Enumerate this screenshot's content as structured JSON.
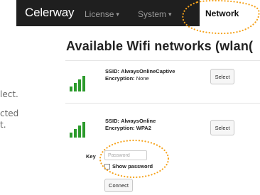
{
  "navbar": {
    "brand": "Celerway",
    "items": [
      {
        "label": "License",
        "caret": "▾"
      },
      {
        "label": "System",
        "caret": "▾"
      },
      {
        "label": "Network"
      }
    ]
  },
  "page": {
    "title": "Available Wifi networks (wlan("
  },
  "side_text": [
    "lect.",
    "cted",
    "t."
  ],
  "networks": [
    {
      "ssid_label": "SSID:",
      "ssid": "AlwaysOnlineCaptive",
      "enc_label": "Encryption:",
      "encryption": "None",
      "select_label": "Select"
    },
    {
      "ssid_label": "SSID:",
      "ssid": "AlwaysOnline",
      "enc_label": "Encryption:",
      "encryption": "WPA2",
      "select_label": "Select"
    }
  ],
  "key_form": {
    "key_label": "Key",
    "password_placeholder": "Password",
    "show_password_label": "Show password",
    "connect_label": "Connect"
  },
  "colors": {
    "navbar_bg": "#1f1f1f",
    "signal_green": "#2c9b2c",
    "annotation_orange": "#f5a21b"
  }
}
